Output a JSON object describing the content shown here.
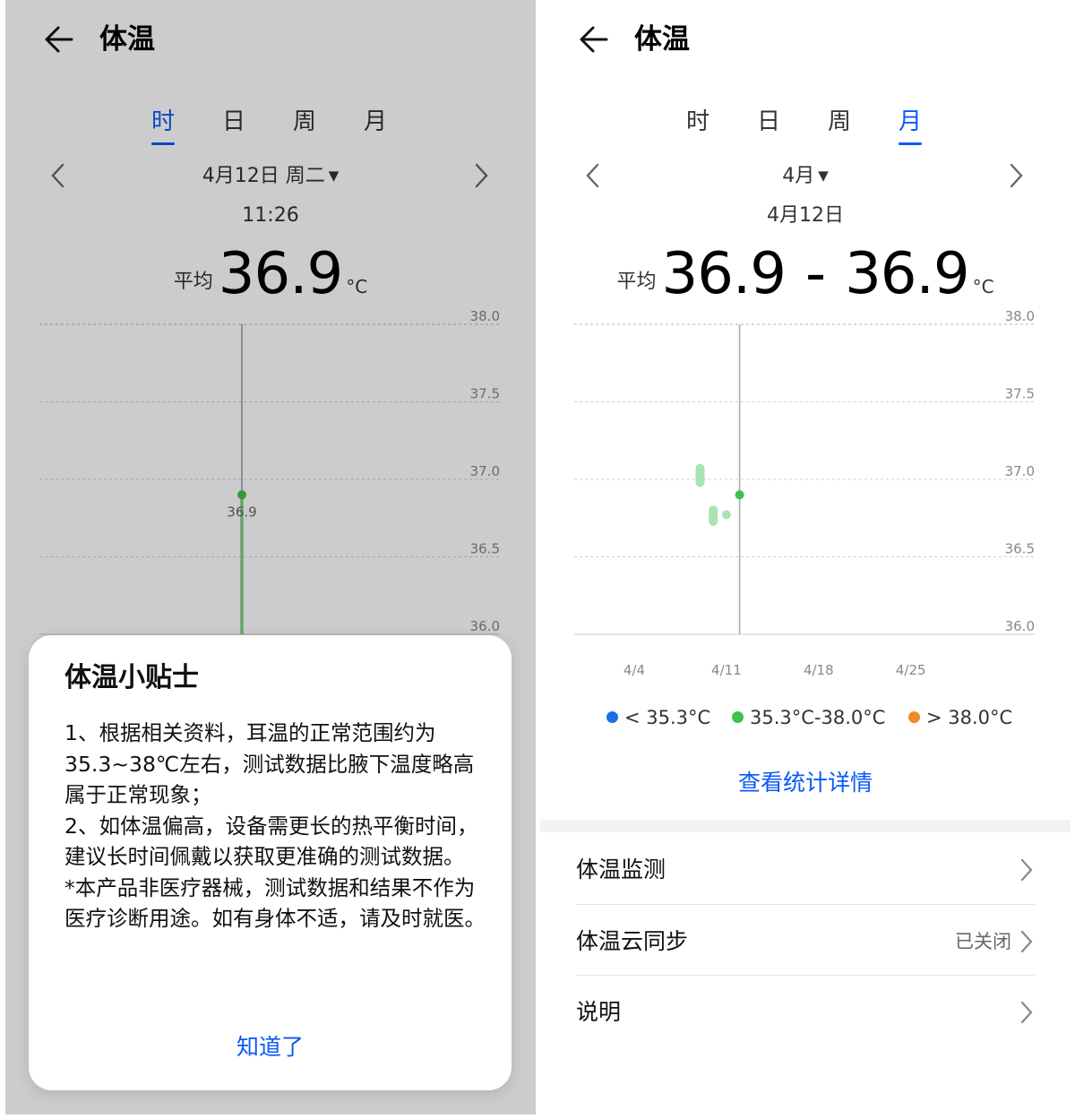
{
  "colors": {
    "accent": "#0a59f7",
    "low": "#1a6fe8",
    "normal": "#3cc24a",
    "high": "#f08a24",
    "limit_line": "#e2a584"
  },
  "left": {
    "header": {
      "title": "体温",
      "back_icon": "arrow-left-icon"
    },
    "tabs": [
      {
        "label": "时",
        "active": true
      },
      {
        "label": "日",
        "active": false
      },
      {
        "label": "周",
        "active": false
      },
      {
        "label": "月",
        "active": false
      }
    ],
    "date": "4月12日 周二",
    "caret": "▼",
    "time": "11:26",
    "reading": {
      "label": "平均",
      "value": "36.9",
      "unit": "°C"
    },
    "chart_data": {
      "type": "line",
      "ylim": [
        36.0,
        38.0
      ],
      "yticks": [
        "38.0",
        "37.5",
        "37.0",
        "36.5",
        "36.0"
      ],
      "points": [
        {
          "x": "11:26",
          "y": 36.9,
          "label": "36.9"
        }
      ]
    },
    "dialog": {
      "title": "体温小贴士",
      "paragraphs": [
        "1、根据相关资料，耳温的正常范围约为35.3~38℃左右，测试数据比腋下温度略高属于正常现象；",
        "2、如体温偏高，设备需更长的热平衡时间，建议长时间佩戴以获取更准确的测试数据。",
        "*本产品非医疗器械，测试数据和结果不作为医疗诊断用途。如有身体不适，请及时就医。"
      ],
      "confirm_label": "知道了"
    }
  },
  "right": {
    "header": {
      "title": "体温",
      "back_icon": "arrow-left-icon"
    },
    "tabs": [
      {
        "label": "时",
        "active": false
      },
      {
        "label": "日",
        "active": false
      },
      {
        "label": "周",
        "active": false
      },
      {
        "label": "月",
        "active": true
      }
    ],
    "date": "4月",
    "caret": "▼",
    "subdate": "4月12日",
    "reading": {
      "label": "平均",
      "low": "36.9",
      "dash": "-",
      "high": "36.9",
      "unit": "°C"
    },
    "chart_data": {
      "type": "scatter",
      "ylim": [
        36.0,
        38.0
      ],
      "yticks": [
        "38.0",
        "37.5",
        "37.0",
        "36.5",
        "36.0"
      ],
      "xticks": [
        "4/4",
        "4/11",
        "4/18",
        "4/25"
      ],
      "ranges": [
        {
          "day": 9,
          "min": 36.95,
          "max": 37.1
        },
        {
          "day": 10,
          "min": 36.7,
          "max": 36.83
        },
        {
          "day": 11,
          "min": 36.78,
          "max": 36.8
        }
      ],
      "selected": {
        "day": 12,
        "value": 36.9
      }
    },
    "legend": [
      {
        "label": "< 35.3°C",
        "color": "#1a6fe8"
      },
      {
        "label": "35.3°C-38.0°C",
        "color": "#3cc24a"
      },
      {
        "label": "> 38.0°C",
        "color": "#f08a24"
      }
    ],
    "stats_link": "查看统计详情",
    "list": [
      {
        "label": "体温监测",
        "value": ""
      },
      {
        "label": "体温云同步",
        "value": "已关闭"
      },
      {
        "label": "说明",
        "value": ""
      }
    ]
  }
}
